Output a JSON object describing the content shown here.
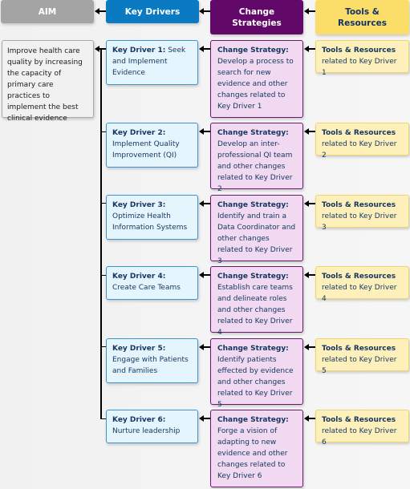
{
  "headers": {
    "aim": "AIM",
    "key_drivers": "Key Drivers",
    "change_strategies": "Change Strategies",
    "tools_resources": "Tools & Resources"
  },
  "aim": {
    "text": "Improve health care quality by increasing the capacity of primary care practices to implement the best clinical evidence"
  },
  "rows": [
    {
      "key_driver": {
        "label": "Key Driver 1:",
        "text": "Seek and Implement Evidence"
      },
      "change_strategy": {
        "label": "Change Strategy:",
        "text": "Develop a process to search for new evidence and other changes related to Key Driver 1"
      },
      "tools": {
        "label": "Tools & Resources",
        "text": "related to Key Driver 1"
      }
    },
    {
      "key_driver": {
        "label": "Key Driver 2:",
        "text": "Implement Quality Improvement (QI)"
      },
      "change_strategy": {
        "label": "Change Strategy:",
        "text": "Develop an inter-professional QI team and other changes related to Key Driver 2"
      },
      "tools": {
        "label": "Tools & Resources",
        "text": "related to Key Driver 2"
      }
    },
    {
      "key_driver": {
        "label": "Key Driver 3:",
        "text": "Optimize Health Information Systems"
      },
      "change_strategy": {
        "label": "Change Strategy:",
        "text": "Identify and train a Data Coordinator and other changes related to Key Driver 3"
      },
      "tools": {
        "label": "Tools & Resources",
        "text": "related to Key Driver 3"
      }
    },
    {
      "key_driver": {
        "label": "Key Driver 4:",
        "text": "Create Care Teams"
      },
      "change_strategy": {
        "label": "Change Strategy:",
        "text": "Establish care teams and delineate roles and other changes related to Key Driver 4"
      },
      "tools": {
        "label": "Tools & Resources",
        "text": "related to Key Driver 4"
      }
    },
    {
      "key_driver": {
        "label": "Key Driver 5:",
        "text": "Engage with Patients and Families"
      },
      "change_strategy": {
        "label": "Change Strategy:",
        "text": "Identify patients effected by evidence and other changes related to Key Driver 5"
      },
      "tools": {
        "label": "Tools & Resources",
        "text": "related to Key Driver 5"
      }
    },
    {
      "key_driver": {
        "label": "Key Driver 6:",
        "text": "Nurture leadership"
      },
      "change_strategy": {
        "label": "Change Strategy:",
        "text": "Forge a vision of adapting to new evidence and other changes related to Key Driver 6"
      },
      "tools": {
        "label": "Tools & Resources",
        "text": "related to Key Driver 6"
      }
    }
  ],
  "colors": {
    "aim": "#a4a4a4",
    "key_drivers": "#0a7bc2",
    "change_strategies": "#620868",
    "tools_resources": "#fbde6a",
    "text_navy": "#14355f"
  }
}
